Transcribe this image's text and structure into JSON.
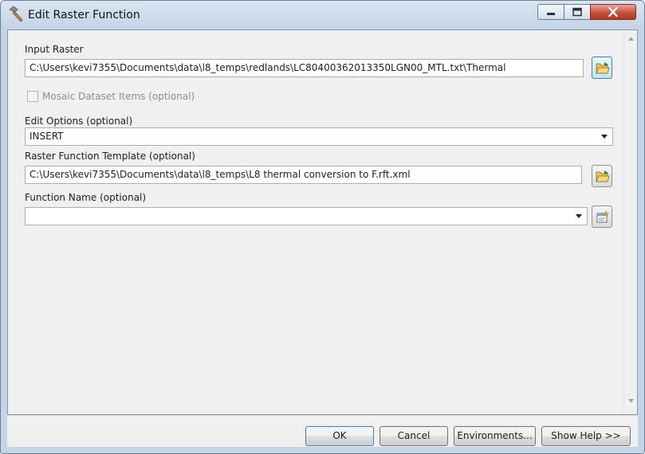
{
  "window": {
    "title": "Edit Raster Function",
    "controls": [
      "minimize-icon",
      "maximize-icon",
      "close-icon"
    ]
  },
  "form": {
    "input_raster": {
      "label": "Input Raster",
      "value": "C:\\Users\\kevi7355\\Documents\\data\\l8_temps\\redlands\\LC80400362013350LGN00_MTL.txt\\Thermal",
      "browse_icon": "folder-open-icon"
    },
    "mosaic_items": {
      "label": "Mosaic Dataset Items (optional)",
      "checked": false,
      "enabled": false
    },
    "edit_options": {
      "label": "Edit Options (optional)",
      "selected": "INSERT"
    },
    "template": {
      "label": "Raster Function Template (optional)",
      "value": "C:\\Users\\kevi7355\\Documents\\data\\l8_temps\\L8 thermal conversion to F.rft.xml",
      "browse_icon": "folder-open-icon"
    },
    "function_name": {
      "label": "Function Name (optional)",
      "selected": "",
      "action_icon": "properties-icon"
    }
  },
  "buttons": {
    "ok": "OK",
    "cancel": "Cancel",
    "environments": "Environments...",
    "help": "Show Help >>"
  },
  "colors": {
    "frame": "#c6d5e6",
    "close_button": "#c84f37",
    "client_background": "#f0f0f0",
    "focus_border": "#3c7fb1"
  }
}
